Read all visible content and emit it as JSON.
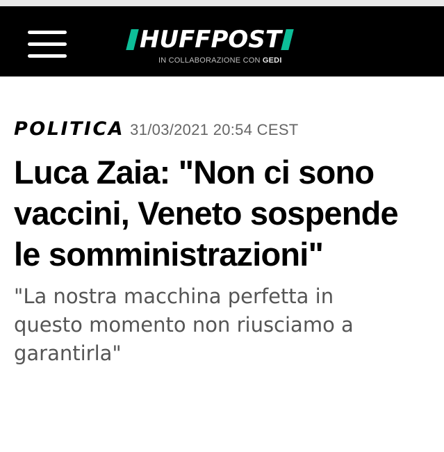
{
  "header": {
    "logo_text": "HUFFPOST",
    "logo_sub_prefix": "IN COLLABORAZIONE CON",
    "logo_sub_brand": "GEDI",
    "logo_accent": "#0dbe98",
    "background": "#000000",
    "menu_icon": "hamburger-menu-icon"
  },
  "article": {
    "section": "POLITICA",
    "datetime": "31/03/2021 20:54 CEST",
    "headline": "Luca Zaia: \"Non ci sono vaccini, Veneto sospende le somministrazioni\"",
    "subtitle": "\"La nostra macchina perfetta in questo momento non riusciamo a garantirla\""
  }
}
